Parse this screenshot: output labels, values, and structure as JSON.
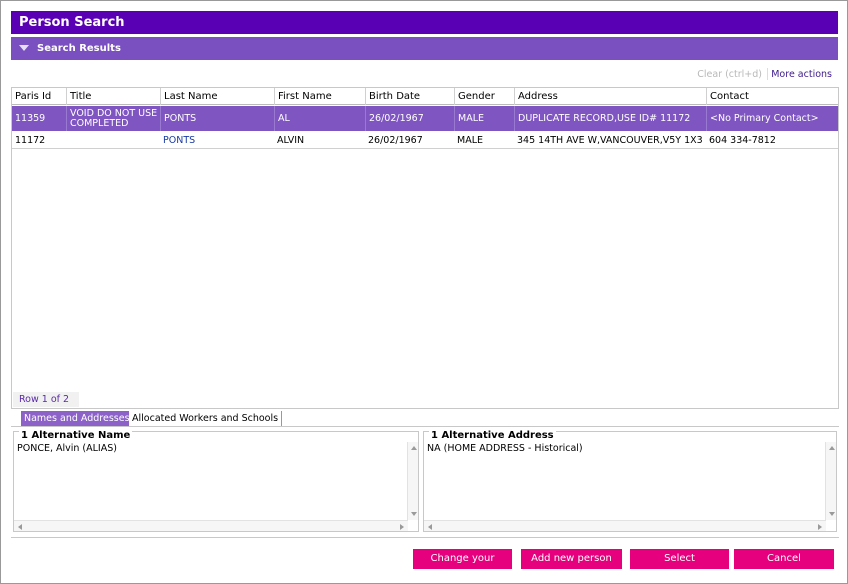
{
  "title": "Person Search",
  "section": {
    "label": "Search Results",
    "icon": "collapse-triangle-icon"
  },
  "toolbar": {
    "clear_label": "Clear (ctrl+d)",
    "more_actions_label": "More actions"
  },
  "table": {
    "columns": [
      "Paris Id",
      "Title",
      "Last Name",
      "First Name",
      "Birth Date",
      "Gender",
      "Address",
      "Contact"
    ],
    "rows": [
      {
        "paris_id": "11359",
        "title": "VOID DO NOT USE COMPLETED",
        "last_name": "PONTS",
        "first_name": "AL",
        "birth_date": "26/02/1967",
        "gender": "MALE",
        "address": "DUPLICATE RECORD,USE ID# 11172",
        "contact": "<No Primary Contact>"
      },
      {
        "paris_id": "11172",
        "title": "",
        "last_name": "PONTS",
        "first_name": "ALVIN",
        "birth_date": "26/02/1967",
        "gender": "MALE",
        "address": "345 14TH AVE W,VANCOUVER,V5Y 1X3",
        "contact": "604 334-7812"
      }
    ],
    "row_count": "Row 1 of 2"
  },
  "tabs": [
    {
      "label": "Names and Addresses",
      "active": true
    },
    {
      "label": "Allocated Workers and Schools",
      "active": false
    }
  ],
  "alt_name": {
    "title": "1 Alternative Name",
    "value": "PONCE, Alvin (ALIAS)"
  },
  "alt_address": {
    "title": "1 Alternative Address",
    "value": "NA (HOME ADDRESS - Historical)"
  },
  "buttons": {
    "change_search": "Change your search",
    "add_person": "Add new person",
    "select": "Select",
    "cancel": "Cancel"
  },
  "colors": {
    "title_bar": "#5a00b4",
    "section_bar": "#7a4fc0",
    "selected_row": "#7f55c2",
    "button": "#e6007e",
    "link": "#1a3aa6"
  }
}
